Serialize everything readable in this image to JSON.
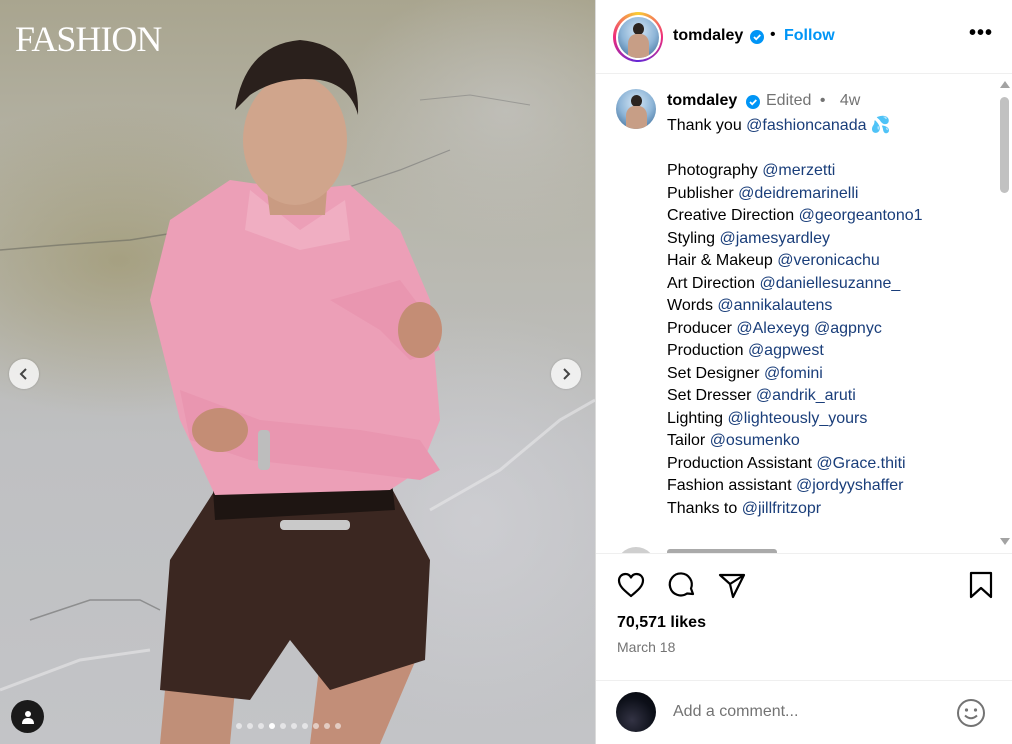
{
  "photo": {
    "magazine_logo": "FASHION",
    "carousel": {
      "total_images": 10,
      "active_index": 3
    }
  },
  "header": {
    "username": "tomdaley",
    "verified": true,
    "separator": "•",
    "follow_label": "Follow",
    "more_label": "•••"
  },
  "caption": {
    "username": "tomdaley",
    "edited_label": "Edited",
    "separator": "•",
    "age": "4w",
    "lines": [
      {
        "text": "Thank you ",
        "mention": "@fashioncanada",
        "suffix": " 💦"
      },
      {
        "text": "",
        "mention": "",
        "suffix": ""
      },
      {
        "text": "Photography ",
        "mention": "@merzetti",
        "suffix": ""
      },
      {
        "text": "Publisher ",
        "mention": "@deidremarinelli",
        "suffix": ""
      },
      {
        "text": "Creative Direction ",
        "mention": "@georgeantono1",
        "suffix": ""
      },
      {
        "text": "Styling ",
        "mention": "@jamesyardley",
        "suffix": ""
      },
      {
        "text": "Hair & Makeup ",
        "mention": "@veronicachu",
        "suffix": ""
      },
      {
        "text": "Art Direction ",
        "mention": "@daniellesuzanne_",
        "suffix": ""
      },
      {
        "text": "Words ",
        "mention": "@annikalautens",
        "suffix": ""
      },
      {
        "text": "Producer ",
        "mention": "@Alexeyg @agpnyc",
        "suffix": ""
      },
      {
        "text": "Production ",
        "mention": "@agpwest",
        "suffix": ""
      },
      {
        "text": "Set Designer ",
        "mention": "@fomini",
        "suffix": ""
      },
      {
        "text": "Set Dresser ",
        "mention": "@andrik_aruti",
        "suffix": ""
      },
      {
        "text": "Lighting ",
        "mention": "@lighteously_yours",
        "suffix": ""
      },
      {
        "text": "Tailor ",
        "mention": "@osumenko",
        "suffix": ""
      },
      {
        "text": "Production Assistant ",
        "mention": "@Grace.thiti",
        "suffix": ""
      },
      {
        "text": "Fashion assistant ",
        "mention": "@jordyyshaffer",
        "suffix": ""
      },
      {
        "text": "Thanks to ",
        "mention": "@jillfritzopr",
        "suffix": ""
      }
    ]
  },
  "actions": {
    "like_icon": "heart-icon",
    "comment_icon": "comment-icon",
    "share_icon": "send-icon",
    "save_icon": "bookmark-icon"
  },
  "stats": {
    "likes": "70,571 likes",
    "date": "March 18"
  },
  "comment_box": {
    "placeholder": "Add a comment...",
    "emoji_icon": "emoji-icon"
  },
  "colors": {
    "follow_blue": "#0095f6",
    "mention_blue": "#1a3e7a",
    "verified_blue": "#0095f6",
    "secondary_text": "#737373"
  }
}
